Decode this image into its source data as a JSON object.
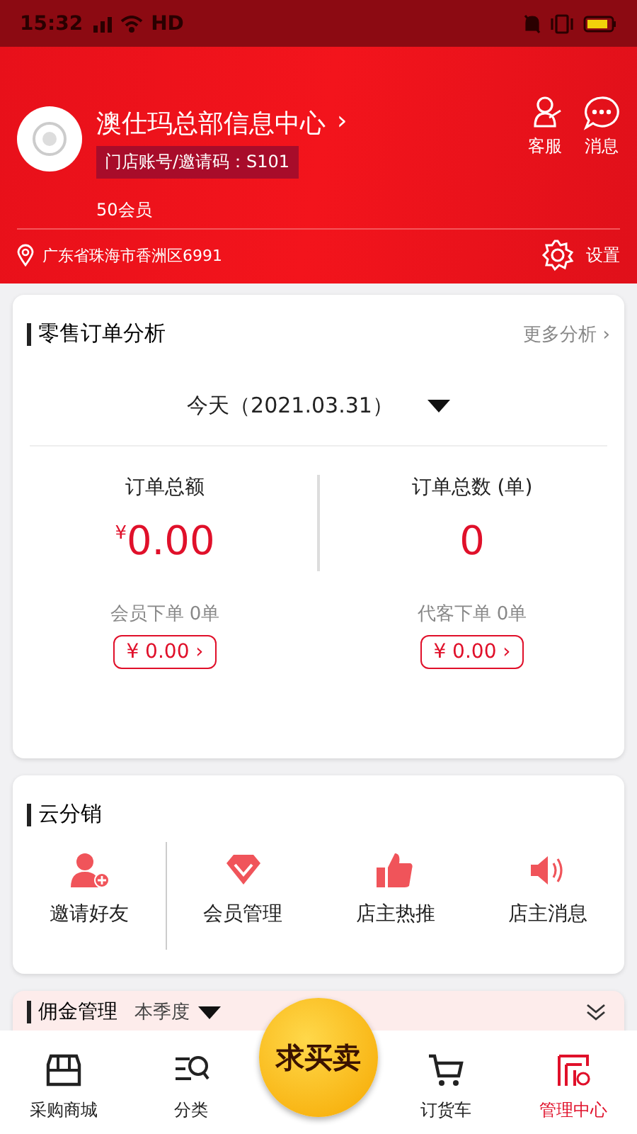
{
  "status_bar": {
    "time": "15:32",
    "network": "HD"
  },
  "profile": {
    "name": "澳仕玛总部信息中心",
    "chevron": "›",
    "store_code": "门店账号/邀请码：S101",
    "members": "50会员",
    "location": "广东省珠海市香洲区6991"
  },
  "header_actions": [
    {
      "kind": "service",
      "label": "客服"
    },
    {
      "kind": "message",
      "label": "消息"
    }
  ],
  "settings": {
    "label": "设置"
  },
  "retail_analysis": {
    "title": "零售订单分析",
    "more": "更多分析",
    "more_chevron": "›",
    "date": "今天（2021.03.31）",
    "stats": [
      {
        "label": "订单总额",
        "currency": "¥",
        "value": "0.00",
        "sub": "会员下单 0单",
        "amount": "¥ 0.00",
        "chevron": "›"
      },
      {
        "label": "订单总数 (单)",
        "value": "0",
        "sub": "代客下单 0单",
        "amount": "¥ 0.00",
        "chevron": "›"
      }
    ]
  },
  "cloud_distribution": {
    "title": "云分销",
    "items": [
      {
        "kind": "invite",
        "label": "邀请好友"
      },
      {
        "kind": "member",
        "label": "会员管理"
      },
      {
        "kind": "recommend",
        "label": "店主热推"
      },
      {
        "kind": "notice",
        "label": "店主消息"
      }
    ]
  },
  "commission": {
    "title": "佣金管理",
    "period": "本季度"
  },
  "tab_bar": {
    "tabs": [
      {
        "kind": "store",
        "label": "采购商城",
        "selected": false
      },
      {
        "kind": "category",
        "label": "分类",
        "selected": false
      },
      {
        "kind": "center",
        "label": "求买卖",
        "selected": false
      },
      {
        "kind": "cart",
        "label": "订货车",
        "selected": false
      },
      {
        "kind": "manage",
        "label": "管理中心",
        "selected": true
      }
    ]
  }
}
